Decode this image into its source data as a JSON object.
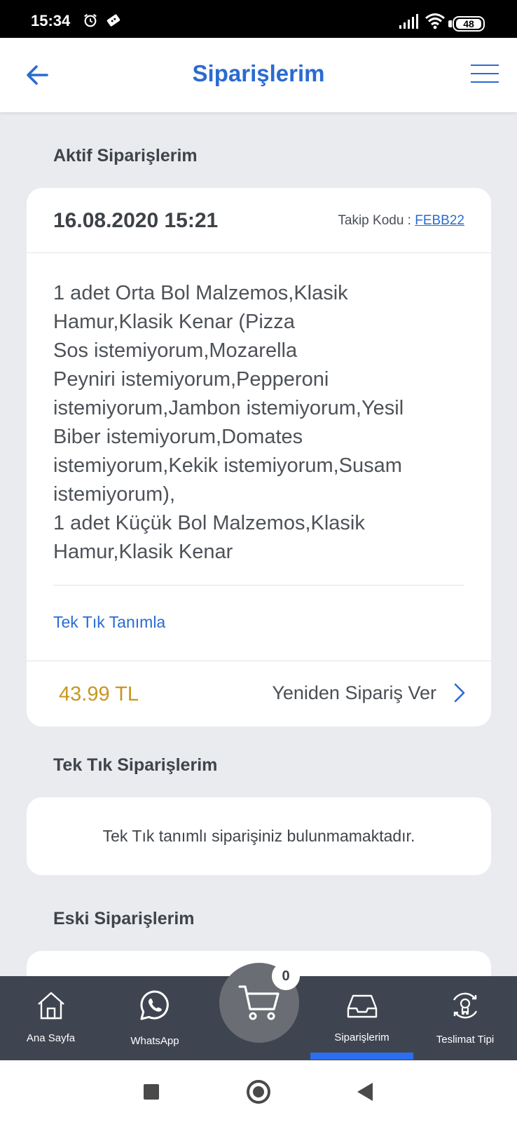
{
  "status_bar": {
    "time": "15:34",
    "battery": "48"
  },
  "header": {
    "title": "Siparişlerim",
    "back_icon": "arrow-left-icon",
    "menu_icon": "hamburger-icon"
  },
  "colors": {
    "accent": "#2a6bd1",
    "price": "#c9971e",
    "nav_bg": "#3f4550",
    "active_indicator": "#2b6ef0"
  },
  "active_orders": {
    "title": "Aktif Siparişlerim",
    "order": {
      "date": "16.08.2020 15:21",
      "tracking_label": "Takip Kodu : ",
      "tracking_code": "FEBB22",
      "description_lines": [
        "1 adet Orta Bol Malzemos,Klasik",
        "Hamur,Klasik Kenar (Pizza",
        "Sos istemiyorum,Mozarella",
        "Peyniri istemiyorum,Pepperoni",
        "istemiyorum,Jambon istemiyorum,Yesil",
        "Biber istemiyorum,Domates",
        "istemiyorum,Kekik istemiyorum,Susam",
        "istemiyorum),",
        "1 adet Küçük Bol Malzemos,Klasik",
        "Hamur,Klasik Kenar"
      ],
      "one_click_link": "Tek Tık Tanımla",
      "price": "43.99 TL",
      "reorder_label": "Yeniden Sipariş Ver"
    }
  },
  "one_click_orders": {
    "title": "Tek Tık Siparişlerim",
    "empty_text": "Tek Tık tanımlı siparişiniz bulunmamaktadır."
  },
  "old_orders": {
    "title": "Eski Siparişlerim"
  },
  "bottom_nav": {
    "items": [
      {
        "label": "Ana Sayfa",
        "icon": "home-icon"
      },
      {
        "label": "WhatsApp",
        "icon": "whatsapp-icon"
      },
      {
        "label": "Siparişlerim",
        "icon": "inbox-tray-icon",
        "active": true
      },
      {
        "label": "Teslimat Tipi",
        "icon": "delivery-type-icon"
      }
    ],
    "cart_count": "0"
  }
}
